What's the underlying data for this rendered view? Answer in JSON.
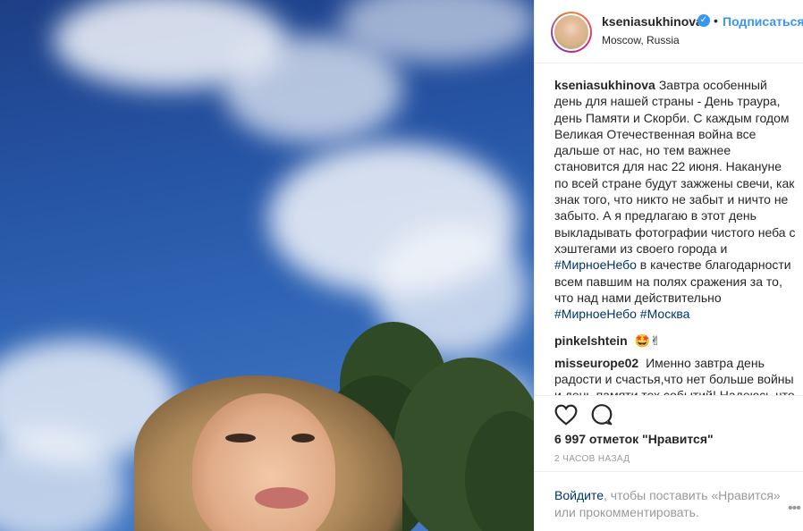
{
  "post": {
    "photo_icon": "selfie-photo-sky",
    "header": {
      "username": "kseniasukhinova",
      "verified_icon": "verified-badge-icon",
      "separator": "•",
      "follow_label": "Подписаться",
      "location": "Moscow, Russia"
    },
    "caption": {
      "username": "kseniasukhinova",
      "text": "Завтра особенный день для нашей страны - День траура, день Памяти и Скорби. С каждым годом Великая Отечественная война все дальше от нас, но тем важнее становится для нас 22 июня. Накануне по всей стране будут зажжены свечи, как знак того, что никто не забыт и ничто не забыто. А я предлагаю в этот день выкладывать фотографии чистого неба с хэштегами из своего города и",
      "tag1": "#МирноеНебо",
      "text2": "в качестве благодарности всем павшим на полях сражения за то, что над нами действительно",
      "tag2": "#МирноеНебо",
      "tag3": "#Москва"
    },
    "comments": [
      {
        "username": "pinkelshtein",
        "text": "🤩✌"
      },
      {
        "username": "misseurope02",
        "text": "Именно завтра день радости и счастья,что нет больше войны и день памяти тех событий! Надеюсь что"
      }
    ],
    "actions": {
      "like_icon": "heart-icon",
      "comment_icon": "comment-bubble-icon"
    },
    "likes": "6 997 отметок \"Нравится\"",
    "timestamp": "2 ЧАСОВ НАЗАД",
    "footer": {
      "login_link": "Войдите",
      "login_text": ", чтобы поставить «Нравится» или прокомментировать.",
      "more_label": "•••"
    }
  }
}
